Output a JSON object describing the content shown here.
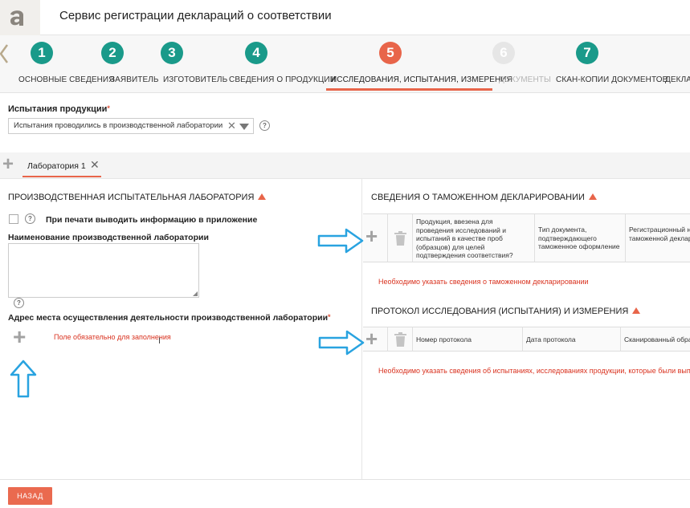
{
  "header": {
    "title": "Сервис регистрации деклараций о соответствии"
  },
  "colors": {
    "accent": "#e8654a",
    "step_done": "#1a9a8a",
    "step_disabled": "#e0e0e0",
    "error": "#d9321f",
    "annotation_arrow": "#29a3e0"
  },
  "steps": [
    {
      "num": "1",
      "label": "ОСНОВНЫЕ СВЕДЕНИЯ",
      "state": "done"
    },
    {
      "num": "2",
      "label": "ЗАЯВИТЕЛЬ",
      "state": "done"
    },
    {
      "num": "3",
      "label": "ИЗГОТОВИТЕЛЬ",
      "state": "done"
    },
    {
      "num": "4",
      "label": "СВЕДЕНИЯ О ПРОДУКЦИИ",
      "state": "done"
    },
    {
      "num": "5",
      "label": "ИССЛЕДОВАНИЯ, ИСПЫТАНИЯ, ИЗМЕРЕНИЯ",
      "state": "active"
    },
    {
      "num": "6",
      "label": "ДОКУМЕНТЫ",
      "state": "disabled"
    },
    {
      "num": "7",
      "label": "СКАН-КОПИИ ДОКУМЕНТОВ",
      "state": "done"
    },
    {
      "label": "ДЕКЛАР"
    }
  ],
  "tests": {
    "label": "Испытания продукции",
    "required_mark": "*",
    "value": "Испытания проводились в производственной лаборатории",
    "clear_icon": "close-icon",
    "help": "?"
  },
  "lab_tabs": {
    "add_icon": "plus-icon",
    "tabs": [
      {
        "label": "Лаборатория 1",
        "close": "✕"
      }
    ]
  },
  "left_panel": {
    "title": "ПРОИЗВОДСТВЕННАЯ ИСПЫТАТЕЛЬНАЯ ЛАБОРАТОРИЯ",
    "print_option": "При печати выводить информацию в приложение",
    "help": "?",
    "lab_name_label": "Наименование производственной лаборатории",
    "lab_name_value": "",
    "address_label": "Адрес места осуществления деятельности производственной лаборатории",
    "address_required": "*",
    "address_error": "Поле обязательно для заполнения"
  },
  "customs": {
    "title": "СВЕДЕНИЯ О ТАМОЖЕННОМ ДЕКЛАРИРОВАНИИ",
    "columns": [
      "Продукция, ввезена для проведения исследований и испытаний в качестве проб (образцов) для целей подтверждения соответствия?",
      "Тип документа, подтверждающего таможенное оформление",
      "Регистрационный номер таможенной декларации"
    ],
    "error": "Необходимо указать сведения о таможенном декларировании"
  },
  "protocol": {
    "title": "ПРОТОКОЛ ИССЛЕДОВАНИЯ (ИСПЫТАНИЯ) И ИЗМЕРЕНИЯ",
    "columns": [
      "Номер протокола",
      "Дата протокола",
      "Сканированный образ"
    ],
    "error": "Необходимо указать сведения об испытаниях, исследованиях продукции, которые были выполнены"
  },
  "footer": {
    "back_label": "НАЗАД"
  }
}
